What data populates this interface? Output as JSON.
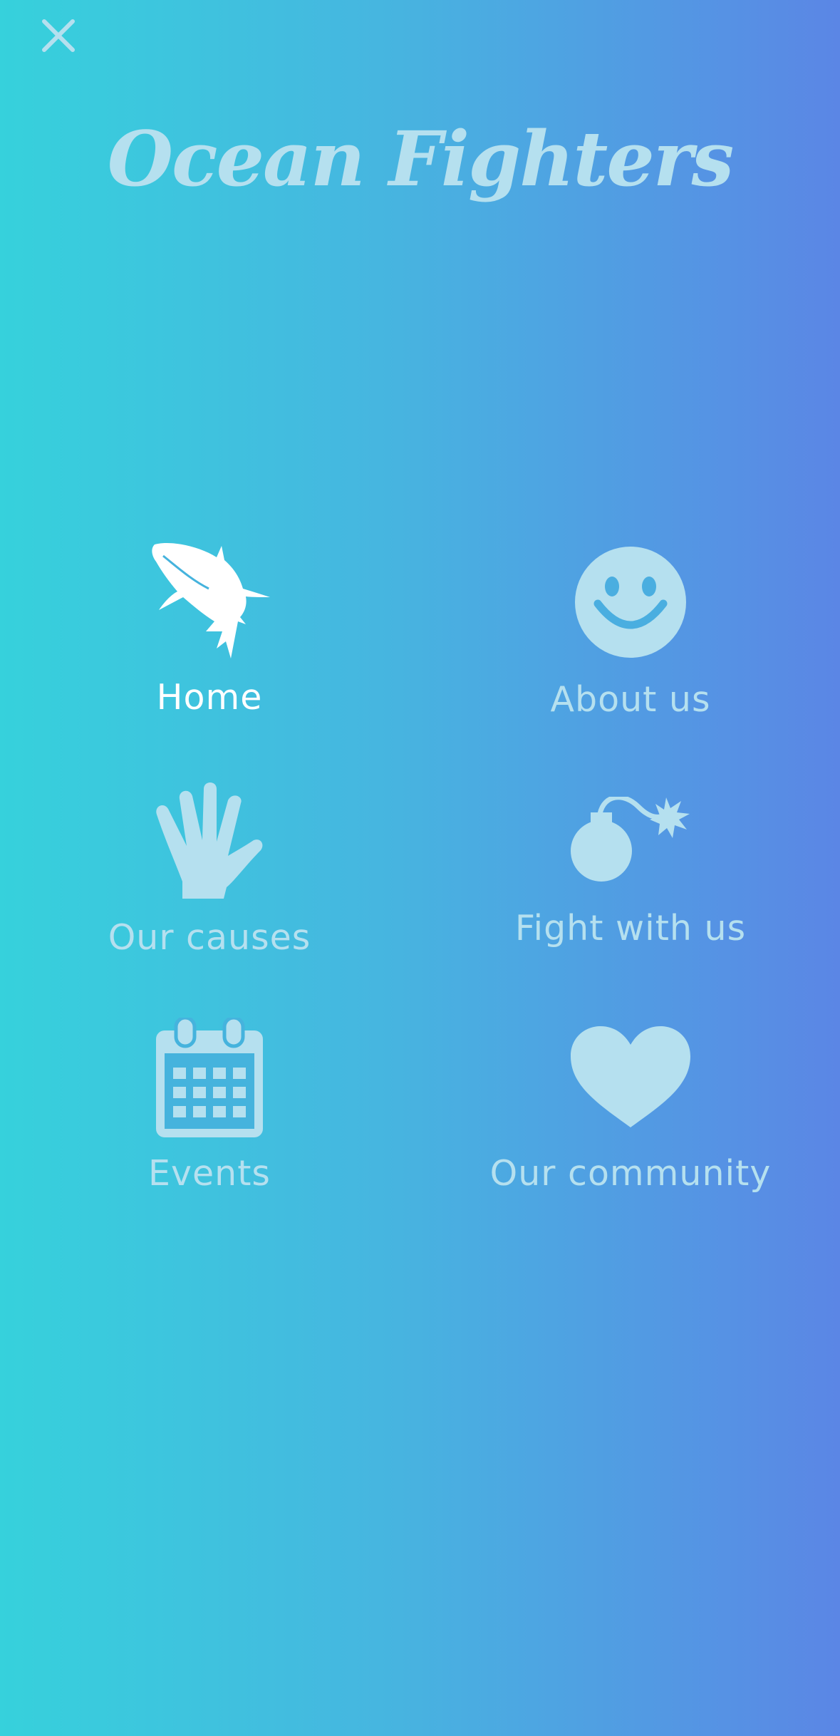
{
  "header": {
    "close_icon": "close-icon",
    "title": "Ocean Fighters"
  },
  "colors": {
    "gradient_start": "#36d1dc",
    "gradient_end": "#5b86e5",
    "icon_text": "#b5e0ef",
    "active": "#ffffff"
  },
  "menu": {
    "active": "Home",
    "items": [
      {
        "label": "Home",
        "icon": "shark-icon"
      },
      {
        "label": "About us",
        "icon": "smiley-icon"
      },
      {
        "label": "Our causes",
        "icon": "hand-icon"
      },
      {
        "label": "Fight with us",
        "icon": "bomb-icon"
      },
      {
        "label": "Events",
        "icon": "calendar-icon"
      },
      {
        "label": "Our community",
        "icon": "heart-icon"
      }
    ]
  }
}
